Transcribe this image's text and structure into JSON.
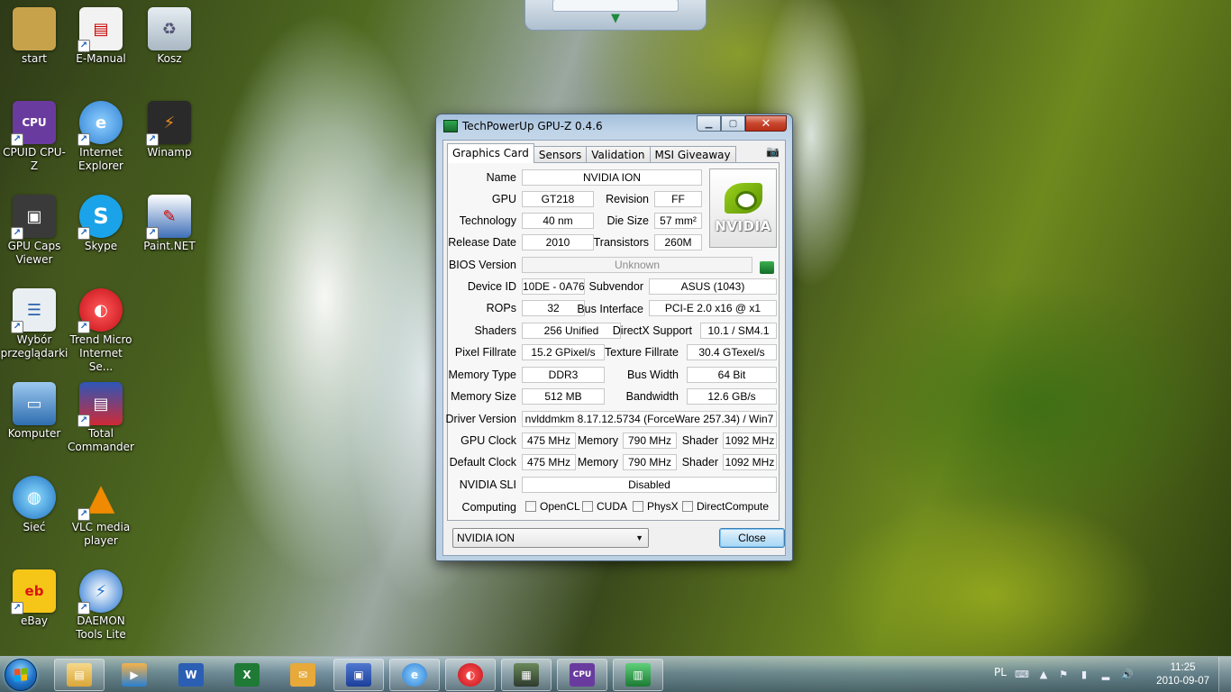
{
  "desktop": {
    "icons": [
      {
        "label": "start",
        "icon": "user-folder-icon",
        "color": "#c8a24a"
      },
      {
        "label": "E-Manual",
        "icon": "pdf-document-icon",
        "color": "#f2f2f2"
      },
      {
        "label": "Kosz",
        "icon": "recycle-bin-icon",
        "color": "#c9d3db"
      },
      {
        "label": "CPUID CPU-Z",
        "icon": "cpu-z-icon",
        "color": "#6a3b9e"
      },
      {
        "label": "Internet Explorer",
        "icon": "internet-explorer-icon",
        "color": "#2d7fd3"
      },
      {
        "label": "Winamp",
        "icon": "winamp-icon",
        "color": "#e98b1d"
      },
      {
        "label": "GPU Caps Viewer",
        "icon": "gpu-caps-icon",
        "color": "#3a3a3a"
      },
      {
        "label": "Skype",
        "icon": "skype-icon",
        "color": "#1aa3e8"
      },
      {
        "label": "Paint.NET",
        "icon": "paint-net-icon",
        "color": "#3f6fb8"
      },
      {
        "label": "Wybór przeglądarki",
        "icon": "browser-choice-icon",
        "color": "#e9eef3"
      },
      {
        "label": "Trend Micro Internet Se...",
        "icon": "trend-micro-icon",
        "color": "#d11f26"
      },
      {
        "label": "Komputer",
        "icon": "computer-icon",
        "color": "#4a88c8"
      },
      {
        "label": "Total Commander",
        "icon": "total-commander-icon",
        "color": "#d02a35"
      },
      {
        "label": "Sieć",
        "icon": "network-icon",
        "color": "#2e8fd8"
      },
      {
        "label": "VLC media player",
        "icon": "vlc-icon",
        "color": "#f08a00"
      },
      {
        "label": "eBay",
        "icon": "ebay-icon",
        "color": "#f5c518"
      },
      {
        "label": "DAEMON Tools Lite",
        "icon": "daemon-tools-icon",
        "color": "#1d6fd0"
      }
    ]
  },
  "gpuz": {
    "title": "TechPowerUp GPU-Z 0.4.6",
    "tabs": [
      "Graphics Card",
      "Sensors",
      "Validation",
      "MSI Giveaway"
    ],
    "logo_text": "NVIDIA",
    "labels": {
      "name": "Name",
      "gpu": "GPU",
      "revision": "Revision",
      "technology": "Technology",
      "die_size": "Die Size",
      "release_date": "Release Date",
      "transistors": "Transistors",
      "bios_version": "BIOS Version",
      "device_id": "Device ID",
      "subvendor": "Subvendor",
      "rops": "ROPs",
      "bus_interface": "Bus Interface",
      "shaders": "Shaders",
      "directx_support": "DirectX Support",
      "pixel_fillrate": "Pixel Fillrate",
      "texture_fillrate": "Texture Fillrate",
      "memory_type": "Memory Type",
      "bus_width": "Bus Width",
      "memory_size": "Memory Size",
      "bandwidth": "Bandwidth",
      "driver_version": "Driver Version",
      "gpu_clock": "GPU Clock",
      "memory": "Memory",
      "shader": "Shader",
      "default_clock": "Default Clock",
      "nvidia_sli": "NVIDIA SLI",
      "computing": "Computing"
    },
    "values": {
      "name": "NVIDIA ION",
      "gpu": "GT218",
      "revision": "FF",
      "technology": "40 nm",
      "die_size": "57 mm²",
      "release_date": "2010",
      "transistors": "260M",
      "bios_version": "Unknown",
      "device_id": "10DE - 0A76",
      "subvendor": "ASUS (1043)",
      "rops": "32",
      "bus_interface": "PCI-E 2.0 x16 @ x1",
      "shaders": "256 Unified",
      "directx_support": "10.1 / SM4.1",
      "pixel_fillrate": "15.2 GPixel/s",
      "texture_fillrate": "30.4 GTexel/s",
      "memory_type": "DDR3",
      "bus_width": "64 Bit",
      "memory_size": "512 MB",
      "bandwidth": "12.6 GB/s",
      "driver_version": "nvlddmkm 8.17.12.5734 (ForceWare 257.34) / Win7",
      "gpu_clock": "475 MHz",
      "gpu_memory": "790 MHz",
      "gpu_shader": "1092 MHz",
      "default_clock": "475 MHz",
      "default_memory": "790 MHz",
      "default_shader": "1092 MHz",
      "nvidia_sli": "Disabled"
    },
    "computing": [
      {
        "label": "OpenCL",
        "checked": false
      },
      {
        "label": "CUDA",
        "checked": false
      },
      {
        "label": "PhysX",
        "checked": false
      },
      {
        "label": "DirectCompute",
        "checked": false
      }
    ],
    "card_select": "NVIDIA ION",
    "close_label": "Close"
  },
  "taskbar": {
    "items": [
      {
        "name": "explorer",
        "icon": "explorer-folder-icon",
        "color": "#e8b94a",
        "open": true
      },
      {
        "name": "media-player",
        "icon": "media-player-icon",
        "color": "#2a7fd0",
        "open": false
      },
      {
        "name": "word",
        "icon": "word-icon",
        "color": "#2b5fb4",
        "open": false
      },
      {
        "name": "excel",
        "icon": "excel-icon",
        "color": "#1f7a35",
        "open": false
      },
      {
        "name": "outlook",
        "icon": "outlook-icon",
        "color": "#e6a93a",
        "open": false
      },
      {
        "name": "total-commander",
        "icon": "total-commander-icon",
        "color": "#1c3f9a",
        "open": true
      },
      {
        "name": "internet-explorer",
        "icon": "internet-explorer-icon",
        "color": "#2d7fd3",
        "open": true
      },
      {
        "name": "trend-micro",
        "icon": "trend-micro-icon",
        "color": "#d11f26",
        "open": true
      },
      {
        "name": "gpu-caps",
        "icon": "gpu-caps-icon",
        "color": "#2e3a2e",
        "open": true
      },
      {
        "name": "cpu-z",
        "icon": "cpu-z-icon",
        "color": "#6a3b9e",
        "open": true
      },
      {
        "name": "gpu-z",
        "icon": "gpu-z-icon",
        "color": "#2fa84f",
        "open": true
      }
    ],
    "tray": {
      "language": "PL",
      "time": "11:25",
      "date": "2010-09-07"
    }
  }
}
